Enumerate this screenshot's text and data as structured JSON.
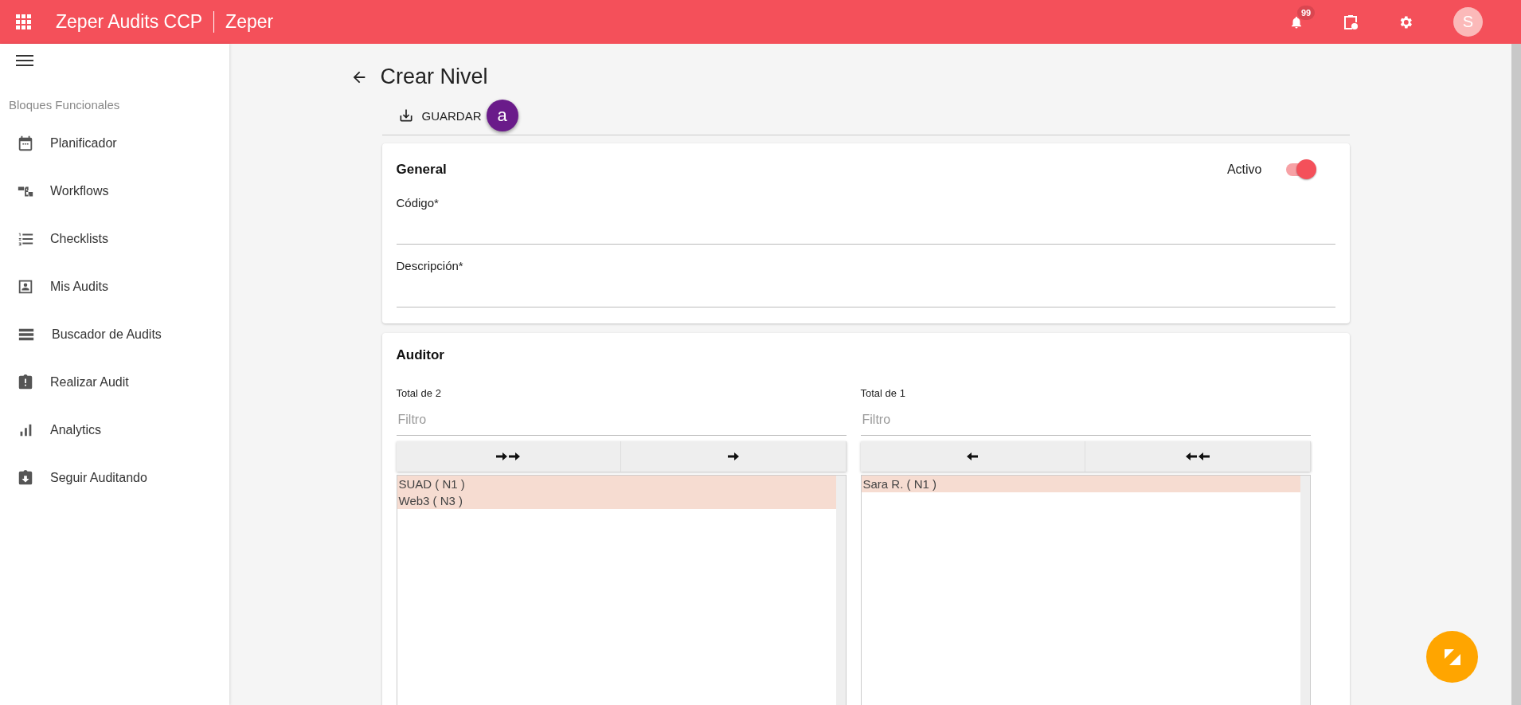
{
  "app_bar": {
    "title_bold": "Zeper Audits",
    "title_light": "CCP",
    "company": "Zeper",
    "notification_count": "99",
    "avatar_letter": "S"
  },
  "sidebar": {
    "section": "Bloques Funcionales",
    "items": [
      {
        "label": "Planificador"
      },
      {
        "label": "Workflows"
      },
      {
        "label": "Checklists"
      },
      {
        "label": "Mis Audits"
      },
      {
        "label": "Buscador de Audits"
      },
      {
        "label": "Realizar Audit"
      },
      {
        "label": "Analytics"
      },
      {
        "label": "Seguir Auditando"
      }
    ]
  },
  "page": {
    "title": "Crear Nivel",
    "save_button": "GUARDAR",
    "badge": "a"
  },
  "general": {
    "title": "General",
    "active_label": "Activo",
    "active": true,
    "fields": [
      {
        "label": "Código*"
      },
      {
        "label": "Descripción*"
      }
    ]
  },
  "auditor": {
    "title": "Auditor",
    "lists": [
      {
        "total": "Total de 2",
        "filter_placeholder": "Filtro",
        "buttons": [
          {
            "kind": "double-right"
          },
          {
            "kind": "right"
          }
        ],
        "items": [
          {
            "label": "SUAD ( N1 )",
            "selected": true
          },
          {
            "label": "Web3 ( N3 )",
            "selected": true
          }
        ]
      },
      {
        "total": "Total de 1",
        "filter_placeholder": "Filtro",
        "buttons": [
          {
            "kind": "left"
          },
          {
            "kind": "double-left"
          }
        ],
        "items": [
          {
            "label": "Sara R. ( N1 )",
            "selected": true
          }
        ]
      }
    ]
  }
}
